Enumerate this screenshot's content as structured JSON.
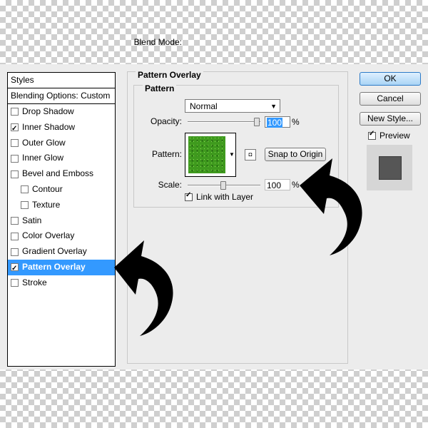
{
  "styles_panel": {
    "header": "Styles",
    "blending_options": "Blending Options: Custom",
    "items": [
      {
        "label": "Drop Shadow",
        "checked": false,
        "indent": false,
        "selected": false
      },
      {
        "label": "Inner Shadow",
        "checked": true,
        "indent": false,
        "selected": false
      },
      {
        "label": "Outer Glow",
        "checked": false,
        "indent": false,
        "selected": false
      },
      {
        "label": "Inner Glow",
        "checked": false,
        "indent": false,
        "selected": false
      },
      {
        "label": "Bevel and Emboss",
        "checked": false,
        "indent": false,
        "selected": false
      },
      {
        "label": "Contour",
        "checked": false,
        "indent": true,
        "selected": false
      },
      {
        "label": "Texture",
        "checked": false,
        "indent": true,
        "selected": false
      },
      {
        "label": "Satin",
        "checked": false,
        "indent": false,
        "selected": false
      },
      {
        "label": "Color Overlay",
        "checked": false,
        "indent": false,
        "selected": false
      },
      {
        "label": "Gradient Overlay",
        "checked": false,
        "indent": false,
        "selected": false
      },
      {
        "label": "Pattern Overlay",
        "checked": true,
        "indent": false,
        "selected": true
      },
      {
        "label": "Stroke",
        "checked": false,
        "indent": false,
        "selected": false
      }
    ]
  },
  "pattern_overlay": {
    "group_title": "Pattern Overlay",
    "subgroup_title": "Pattern",
    "blend_mode_label": "Blend Mode:",
    "blend_mode_value": "Normal",
    "opacity_label": "Opacity:",
    "opacity_value": "100",
    "opacity_unit": "%",
    "pattern_label": "Pattern:",
    "snap_button": "Snap to Origin",
    "scale_label": "Scale:",
    "scale_value": "100",
    "scale_unit": "%",
    "link_label": "Link with Layer",
    "link_checked": true
  },
  "buttons": {
    "ok": "OK",
    "cancel": "Cancel",
    "new_style": "New Style..."
  },
  "preview": {
    "label": "Preview",
    "checked": true
  }
}
